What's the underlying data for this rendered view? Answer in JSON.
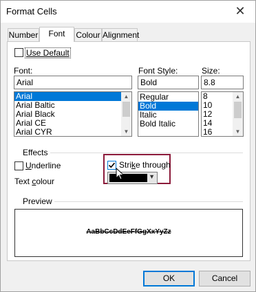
{
  "window": {
    "title": "Format Cells",
    "close_glyph": "✕"
  },
  "tabs": [
    {
      "label": "Number"
    },
    {
      "label": "Font"
    },
    {
      "label": "Colour"
    },
    {
      "label": "Alignment"
    }
  ],
  "font_page": {
    "use_default_label": "Use Default",
    "use_default_checked": false,
    "font_label": "Font:",
    "font_value": "Arial",
    "font_options": [
      "Arial",
      "Arial Baltic",
      "Arial Black",
      "Arial CE",
      "Arial CYR"
    ],
    "font_selected": "Arial",
    "style_label": "Font Style:",
    "style_value": "Bold",
    "style_options": [
      "Regular",
      "Bold",
      "Italic",
      "Bold Italic"
    ],
    "style_selected": "Bold",
    "size_label": "Size:",
    "size_value": "8.8",
    "size_options": [
      "8",
      "10",
      "12",
      "14",
      "16"
    ],
    "effects_label": "Effects",
    "underline_label": "Underline",
    "underline_checked": false,
    "strike_label": "Strike through",
    "strike_checked": true,
    "text_colour_label": "Text colour",
    "text_colour_value": "#000000",
    "preview_label": "Preview",
    "preview_text": "AaBbCcDdEeFfGgXxYyZz"
  },
  "buttons": {
    "ok": "OK",
    "cancel": "Cancel"
  },
  "colors": {
    "selection": "#0078d7",
    "highlight_border": "#8b1a3a",
    "default_button_border": "#0078d7"
  },
  "icons": {
    "close": "close-icon",
    "scroll_up": "chevron-up-icon",
    "scroll_down": "chevron-down-icon",
    "combo": "chevron-down-icon",
    "check": "checkmark-icon",
    "cursor": "mouse-pointer-icon"
  }
}
